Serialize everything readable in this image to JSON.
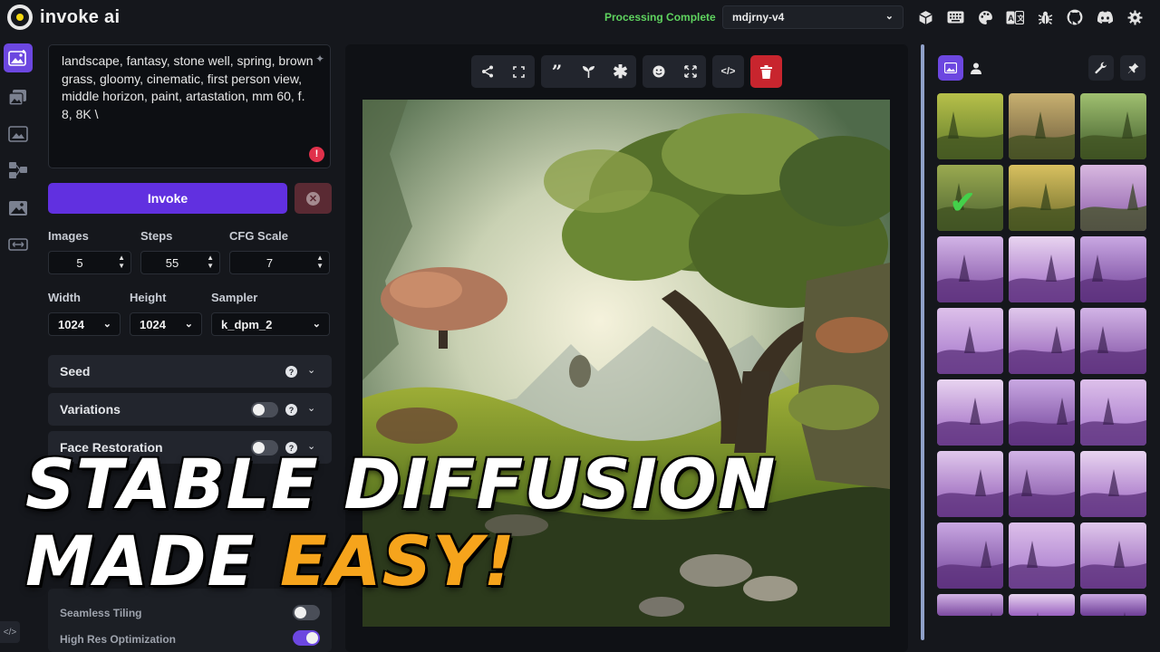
{
  "header": {
    "app_name": "invoke ai",
    "status": "Processing Complete",
    "model": "mdjrny-v4",
    "icons": [
      "cube-icon",
      "keyboard-icon",
      "palette-icon",
      "translate-icon",
      "bug-icon",
      "github-icon",
      "discord-icon",
      "gear-icon"
    ]
  },
  "rail": {
    "items": [
      "text-to-image-icon",
      "image-to-image-icon",
      "unified-canvas-icon",
      "nodes-icon",
      "postprocessing-icon",
      "training-icon"
    ],
    "bottom": "</>"
  },
  "prompt": {
    "text": "landscape, fantasy, stone well, spring, brown grass, gloomy, cinematic, first person view, middle horizon, paint, artastation, mm 60, f. 8, 8K \\"
  },
  "actions": {
    "invoke": "Invoke"
  },
  "params": {
    "images_label": "Images",
    "images": "5",
    "steps_label": "Steps",
    "steps": "55",
    "cfg_label": "CFG Scale",
    "cfg": "7",
    "width_label": "Width",
    "width": "1024",
    "height_label": "Height",
    "height": "1024",
    "sampler_label": "Sampler",
    "sampler": "k_dpm_2"
  },
  "accordions": {
    "seed": "Seed",
    "variations": "Variations",
    "face_restoration": "Face Restoration"
  },
  "lower": {
    "seamless": "Seamless Tiling",
    "highres": "High Res Optimization"
  },
  "toolbar": {
    "groups": [
      [
        "share-icon",
        "expand-icon"
      ],
      [
        "quote-icon",
        "seedling-icon",
        "asterisk-icon"
      ],
      [
        "face-icon",
        "maximize-icon"
      ],
      [
        "code-icon"
      ]
    ],
    "delete": "trash-icon"
  },
  "overlay": {
    "line1": "STABLE DIFFUSION",
    "line2_a": "MADE",
    "line2_b": "EASY!"
  },
  "colors": {
    "accent": "#6130e0",
    "status": "#5fd35f",
    "delete": "#c8252e",
    "overlay_highlight": "#f6a41c"
  }
}
